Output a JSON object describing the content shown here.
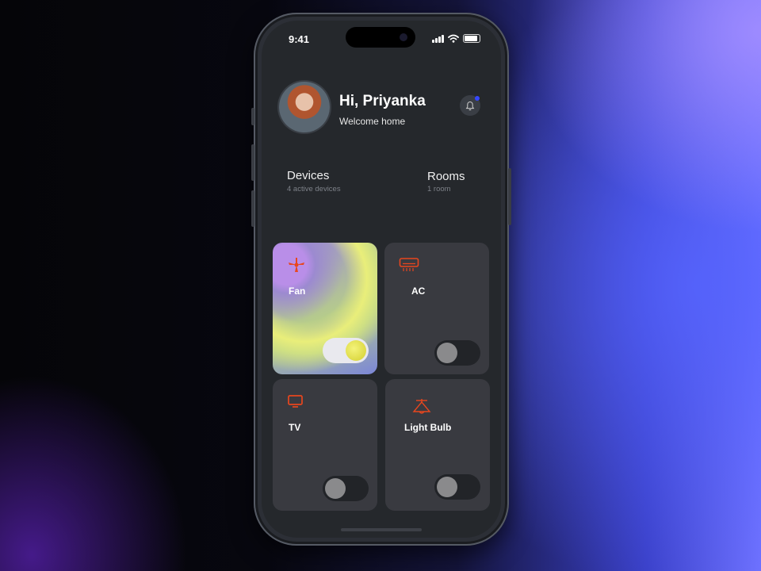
{
  "status": {
    "time": "9:41"
  },
  "user": {
    "greeting": "Hi, Priyanka",
    "subtitle": "Welcome home"
  },
  "tabs": [
    {
      "label": "Devices",
      "sub": "4 active devices"
    },
    {
      "label": "Rooms",
      "sub": "1 room"
    }
  ],
  "devices": [
    {
      "name": "Fan",
      "icon": "fan-icon",
      "on": true
    },
    {
      "name": "AC",
      "icon": "ac-icon",
      "on": false
    },
    {
      "name": "TV",
      "icon": "tv-icon",
      "on": false
    },
    {
      "name": "Light Bulb",
      "icon": "light-bulb-icon",
      "on": false
    }
  ],
  "colors": {
    "accent": "#e8461e",
    "notification_dot": "#3547ff",
    "toggle_on_knob": "#e8e23a"
  }
}
